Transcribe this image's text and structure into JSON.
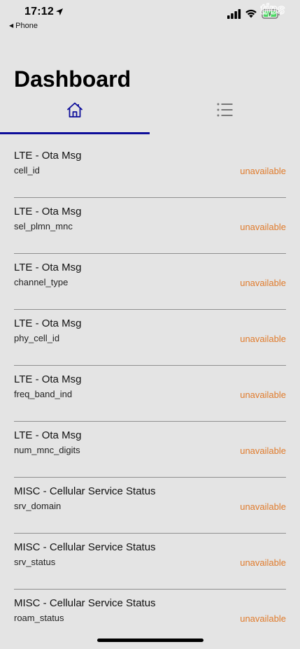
{
  "status_bar": {
    "time": "17:12",
    "back_app": "Phone",
    "watermark": "tips"
  },
  "header": {
    "title": "Dashboard"
  },
  "tabs": [
    {
      "name": "home",
      "icon": "home-icon",
      "active": true
    },
    {
      "name": "list",
      "icon": "list-icon",
      "active": false
    }
  ],
  "colors": {
    "accent": "#0d0d9a",
    "status_unavailable": "#e07b2c",
    "background": "#e4e4e4"
  },
  "items": [
    {
      "title": "LTE - Ota Msg",
      "field": "cell_id",
      "status": "unavailable"
    },
    {
      "title": "LTE - Ota Msg",
      "field": "sel_plmn_mnc",
      "status": "unavailable"
    },
    {
      "title": "LTE - Ota Msg",
      "field": "channel_type",
      "status": "unavailable"
    },
    {
      "title": "LTE - Ota Msg",
      "field": "phy_cell_id",
      "status": "unavailable"
    },
    {
      "title": "LTE - Ota Msg",
      "field": "freq_band_ind",
      "status": "unavailable"
    },
    {
      "title": "LTE - Ota Msg",
      "field": "num_mnc_digits",
      "status": "unavailable"
    },
    {
      "title": "MISC - Cellular Service Status",
      "field": "srv_domain",
      "status": "unavailable"
    },
    {
      "title": "MISC - Cellular Service Status",
      "field": "srv_status",
      "status": "unavailable"
    },
    {
      "title": "MISC - Cellular Service Status",
      "field": "roam_status",
      "status": "unavailable"
    }
  ]
}
